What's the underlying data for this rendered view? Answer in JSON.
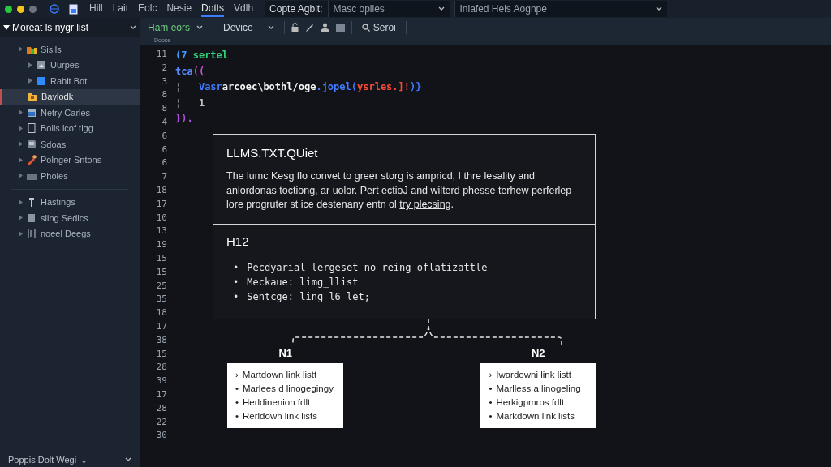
{
  "window": {
    "title_menus": [
      {
        "label": "Hill",
        "selected": false
      },
      {
        "label": "Lait",
        "selected": false
      },
      {
        "label": "Eolc",
        "selected": false
      },
      {
        "label": "Nesie",
        "selected": false
      },
      {
        "label": "Dotts",
        "selected": true
      },
      {
        "label": "Vdlh",
        "selected": false
      }
    ],
    "dropdowns": [
      {
        "label": "Copte Agbit:",
        "value": "Masc opiles"
      },
      {
        "value": "Inlafed  Heis Aognpe"
      }
    ]
  },
  "sidebar": {
    "header": "Moreat ls nygr list",
    "groups": [
      {
        "items": [
          {
            "label": "Sisils",
            "kind": "folder",
            "selected": false,
            "children": [
              {
                "label": "Uurpes",
                "kind": "image",
                "selected": false
              },
              {
                "label": "Rablt Bot",
                "kind": "app",
                "selected": false
              }
            ]
          },
          {
            "label": "Baylodk",
            "kind": "package",
            "selected": true
          },
          {
            "label": "Netry Carles",
            "kind": "window",
            "selected": false
          },
          {
            "label": "Bolls lcof tigg",
            "kind": "file",
            "selected": false
          },
          {
            "label": "Sdoas",
            "kind": "disk",
            "selected": false
          },
          {
            "label": "Polnger Sntons",
            "kind": "tool",
            "selected": false
          },
          {
            "label": "Pholes",
            "kind": "plainfolder",
            "selected": false
          }
        ]
      },
      {
        "items": [
          {
            "label": "Hastings",
            "kind": "pin",
            "selected": false
          },
          {
            "label": "siing Sedlcs",
            "kind": "doc",
            "selected": false
          },
          {
            "label": "noeel Deegs",
            "kind": "ledger",
            "selected": false
          }
        ]
      }
    ],
    "footer": "Poppis Dolt Wegi"
  },
  "toolbar": {
    "scheme": "Ham eors",
    "device": "Device",
    "search": "Seroi",
    "sub_label": "Doose"
  },
  "editor": {
    "line_numbers": [
      "11",
      "2",
      "3",
      "8",
      "8",
      "4",
      "6",
      "6",
      "6",
      "7",
      "18",
      "17",
      "10",
      "13",
      "19",
      "15",
      "15",
      "25",
      "35",
      "18",
      "17",
      "38",
      "15",
      "28",
      "39",
      "17",
      "28",
      "22",
      "30"
    ],
    "code": [
      [
        {
          "text": "(7 ",
          "color": "#3f9bff"
        },
        {
          "text": "sertel",
          "color": "#33d17a"
        }
      ],
      [
        {
          "text": "tca",
          "color": "#5b8cff"
        },
        {
          "text": "((",
          "color": "#d04fd8"
        }
      ],
      [
        {
          "text": "¦",
          "color": "#6b7280"
        },
        {
          "text": "   Vasr",
          "color": "#3f7bff"
        },
        {
          "text": "arcoec\\bothl/oge",
          "color": "#f2f2f2"
        },
        {
          "text": ".jopel(",
          "color": "#3f7bff"
        },
        {
          "text": "ysrles.]!",
          "color": "#ff4b36"
        },
        {
          "text": ")}",
          "color": "#3f7bff"
        }
      ],
      [
        {
          "text": "¦",
          "color": "#6b7280"
        },
        {
          "text": "   1",
          "color": "#c0c0c0"
        }
      ],
      [
        {
          "text": "}).",
          "color": "#b04fe0"
        }
      ]
    ]
  },
  "diagram": {
    "title": "LLMS.TXT.QUiet",
    "paragraph": "The lumc Kesg flo convet to greer storg is ampricd, I thre lesality and anlordonas toctiong, ar uolor. Pert ectioJ and wilterd phesse terhew perferlep lore progruter st ice destenany entn ol ",
    "link": "try plecsing",
    "paragraph_end": ".",
    "section_title": "H12",
    "bullets": [
      {
        "marker": "•",
        "text": "Pecdyarial lergeset no reing oflatizattle"
      },
      {
        "marker": "•",
        "text": "Meckaue: limg_llist"
      },
      {
        "marker": "•",
        "text": "Sentcge: ling_l6_let;"
      }
    ],
    "nodes": [
      {
        "label": "N1",
        "items": [
          {
            "marker": "›",
            "text": "Martdown link listt"
          },
          {
            "marker": "•",
            "text": "Marlees d linogegingy"
          },
          {
            "marker": "•",
            "text": "Herldinenion fdlt"
          },
          {
            "marker": "•",
            "text": "Rerldown link lists"
          }
        ]
      },
      {
        "label": "N2",
        "items": [
          {
            "marker": "›",
            "text": "Iwardowni link listt"
          },
          {
            "marker": "•",
            "text": "Marlless a linogeling"
          },
          {
            "marker": "•",
            "text": "Herkigpmros fdlt"
          },
          {
            "marker": "•",
            "text": "Markdown link lists"
          }
        ]
      }
    ]
  }
}
